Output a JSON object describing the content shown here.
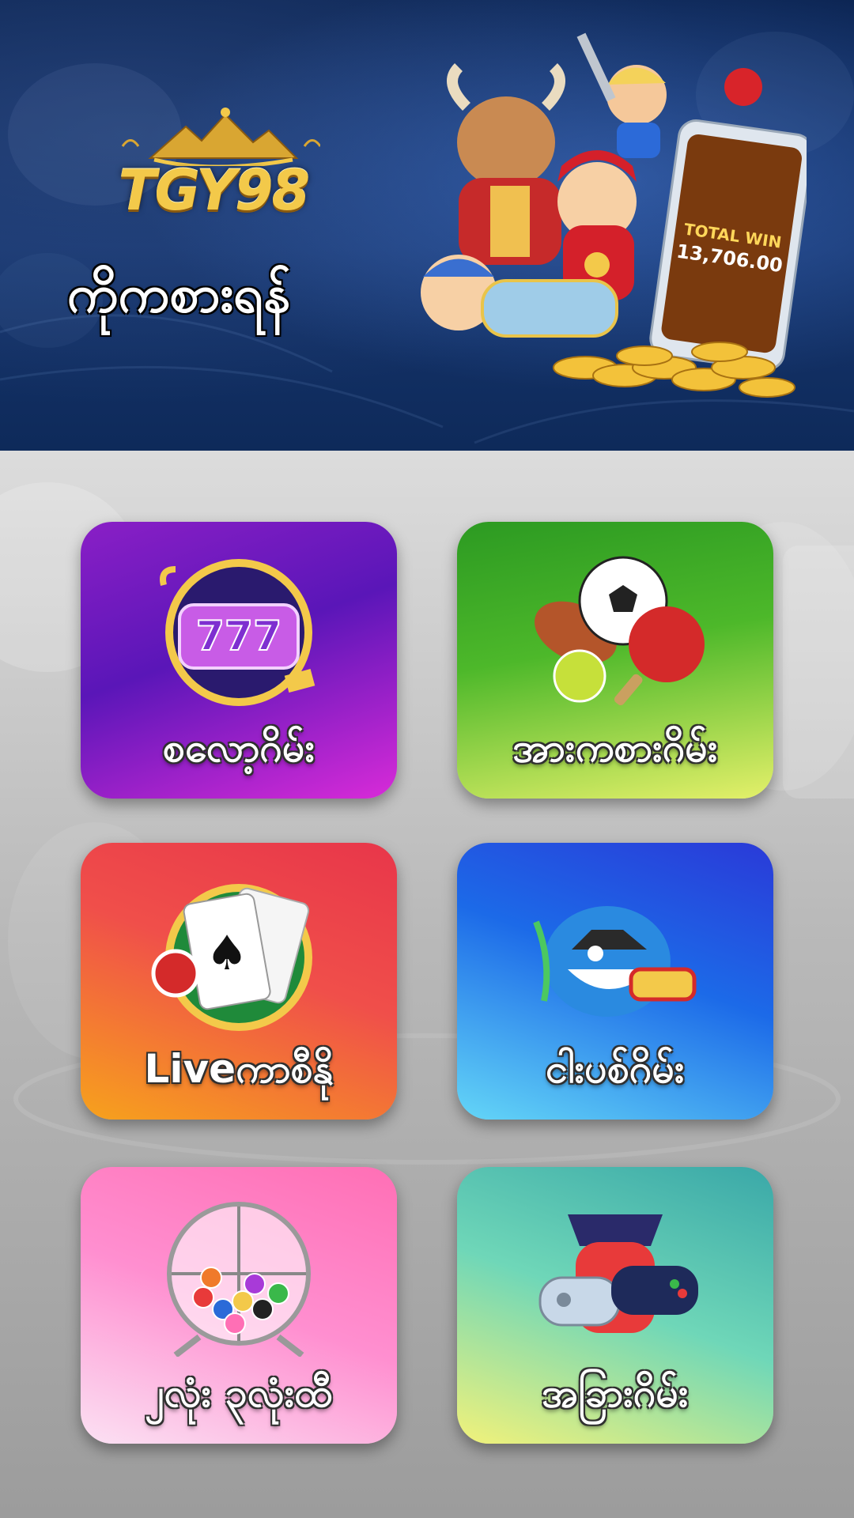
{
  "header": {
    "logo_text": "TGY98",
    "title": "ကိုကစားရန်",
    "hero_screen_text_1": "TOTAL WIN",
    "hero_screen_text_2": "13,706.00"
  },
  "categories": [
    {
      "label": "စလော့ဂိမ်း",
      "icon": "slot-777-icon",
      "color": "#7a1cc4"
    },
    {
      "label": "အားကစားဂိမ်း",
      "icon": "sports-balls-icon",
      "color": "#3aa824"
    },
    {
      "label": "Liveကာစီနို",
      "icon": "playing-cards-icon",
      "color": "#f04848"
    },
    {
      "label": "ငါးပစ်ဂိမ်း",
      "icon": "fish-shooter-icon",
      "color": "#2454e0"
    },
    {
      "label": "၂လုံး ၃လုံးထီ",
      "icon": "lottery-ball-cage-icon",
      "color": "#ff7cc0"
    },
    {
      "label": "အခြားဂိမ်း",
      "icon": "game-controller-icon",
      "color": "#4cbfae"
    }
  ]
}
